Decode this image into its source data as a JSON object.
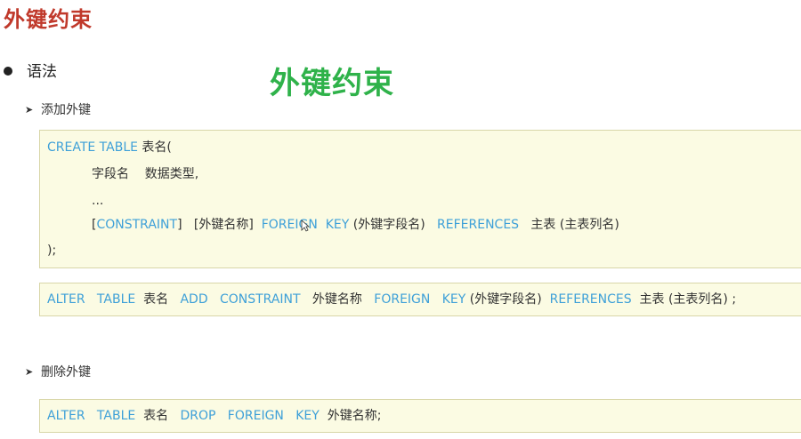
{
  "header": {
    "title": "外键约束",
    "overlay_title": "外键约束"
  },
  "section": {
    "bullet_label": "语法",
    "add_label": "添加外键",
    "delete_label": "删除外键"
  },
  "create_block": {
    "line1": [
      "CREATE TABLE",
      " 表名("
    ],
    "line2": "字段名    数据类型,",
    "line3": "...",
    "line4": [
      "[",
      "CONSTRAINT",
      "]   [外键名称]  ",
      "FOREIGN  KEY",
      " (外键字段名)   ",
      "REFERENCES",
      "   主表 (主表列名)"
    ],
    "line5": ");"
  },
  "alter_add_block": {
    "parts": [
      "ALTER   TABLE",
      "  表名   ",
      "ADD   CONSTRAINT",
      "   外键名称   ",
      "FOREIGN   KEY",
      " (外键字段名)  ",
      "REFERENCES",
      "  主表 (主表列名) ;"
    ]
  },
  "alter_drop_block": {
    "parts": [
      "ALTER   TABLE",
      "  表名   ",
      "DROP   FOREIGN   KEY",
      "  外键名称;"
    ]
  },
  "colors": {
    "title": "#c0392b",
    "overlay": "#2fb24a",
    "keyword": "#3ea0d8",
    "box_bg": "#fbfbe3"
  }
}
